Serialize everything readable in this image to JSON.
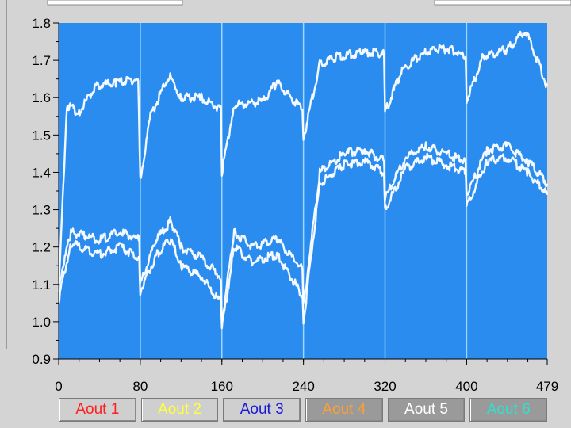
{
  "chart_data": {
    "type": "line",
    "y_ticks": [
      "1.8",
      "1.7",
      "1.6",
      "1.5",
      "1.4",
      "1.3",
      "1.2",
      "1.1",
      "1.0",
      "0.9"
    ],
    "x_ticks": [
      "0",
      "80",
      "160",
      "240",
      "320",
      "400",
      "479"
    ],
    "xlim": [
      0,
      479
    ],
    "ylim": [
      0.9,
      1.8
    ],
    "grid": "vertical at 80,160,240,320,400",
    "plot_bg": "#2b8cf0",
    "line_color": "#ffffff",
    "series": [
      {
        "name": "Aout 1",
        "points": [
          [
            0,
            1.08
          ],
          [
            8,
            1.58
          ],
          [
            20,
            1.56
          ],
          [
            36,
            1.63
          ],
          [
            56,
            1.64
          ],
          [
            78,
            1.65
          ],
          [
            80,
            1.38
          ],
          [
            90,
            1.55
          ],
          [
            108,
            1.66
          ],
          [
            120,
            1.6
          ],
          [
            140,
            1.6
          ],
          [
            159,
            1.57
          ],
          [
            160,
            1.4
          ],
          [
            172,
            1.58
          ],
          [
            200,
            1.59
          ],
          [
            214,
            1.64
          ],
          [
            239,
            1.57
          ],
          [
            240,
            1.49
          ],
          [
            256,
            1.69
          ],
          [
            272,
            1.71
          ],
          [
            296,
            1.72
          ],
          [
            319,
            1.72
          ],
          [
            320,
            1.56
          ],
          [
            336,
            1.67
          ],
          [
            352,
            1.71
          ],
          [
            368,
            1.73
          ],
          [
            384,
            1.73
          ],
          [
            399,
            1.71
          ],
          [
            400,
            1.59
          ],
          [
            416,
            1.71
          ],
          [
            440,
            1.73
          ],
          [
            458,
            1.78
          ],
          [
            479,
            1.63
          ]
        ]
      },
      {
        "name": "Aout 2",
        "points": [
          [
            0,
            1.1
          ],
          [
            12,
            1.24
          ],
          [
            40,
            1.22
          ],
          [
            60,
            1.24
          ],
          [
            79,
            1.22
          ],
          [
            80,
            1.1
          ],
          [
            96,
            1.22
          ],
          [
            110,
            1.27
          ],
          [
            120,
            1.2
          ],
          [
            140,
            1.17
          ],
          [
            159,
            1.12
          ],
          [
            160,
            1.0
          ],
          [
            172,
            1.24
          ],
          [
            190,
            1.2
          ],
          [
            214,
            1.22
          ],
          [
            239,
            1.14
          ],
          [
            240,
            1.04
          ],
          [
            256,
            1.4
          ],
          [
            280,
            1.45
          ],
          [
            300,
            1.46
          ],
          [
            319,
            1.43
          ],
          [
            320,
            1.33
          ],
          [
            340,
            1.44
          ],
          [
            360,
            1.47
          ],
          [
            380,
            1.45
          ],
          [
            399,
            1.43
          ],
          [
            400,
            1.34
          ],
          [
            420,
            1.46
          ],
          [
            440,
            1.47
          ],
          [
            460,
            1.43
          ],
          [
            479,
            1.37
          ]
        ]
      },
      {
        "name": "Aout 3",
        "points": [
          [
            0,
            1.06
          ],
          [
            12,
            1.21
          ],
          [
            40,
            1.18
          ],
          [
            60,
            1.2
          ],
          [
            79,
            1.17
          ],
          [
            80,
            1.08
          ],
          [
            96,
            1.18
          ],
          [
            110,
            1.22
          ],
          [
            120,
            1.15
          ],
          [
            140,
            1.12
          ],
          [
            159,
            1.05
          ],
          [
            160,
            0.98
          ],
          [
            172,
            1.2
          ],
          [
            190,
            1.16
          ],
          [
            214,
            1.18
          ],
          [
            239,
            1.07
          ],
          [
            240,
            1.0
          ],
          [
            256,
            1.37
          ],
          [
            280,
            1.42
          ],
          [
            300,
            1.43
          ],
          [
            319,
            1.4
          ],
          [
            320,
            1.3
          ],
          [
            340,
            1.41
          ],
          [
            360,
            1.44
          ],
          [
            380,
            1.42
          ],
          [
            399,
            1.4
          ],
          [
            400,
            1.31
          ],
          [
            420,
            1.43
          ],
          [
            440,
            1.44
          ],
          [
            460,
            1.4
          ],
          [
            479,
            1.34
          ]
        ]
      },
      {
        "name": "Aout 4",
        "points": []
      },
      {
        "name": "Aout 5",
        "points": []
      },
      {
        "name": "Aout 6",
        "points": []
      }
    ]
  },
  "legend": [
    {
      "label": "Aout 1",
      "color": "#ff2020"
    },
    {
      "label": "Aout 2",
      "color": "#ffff40"
    },
    {
      "label": "Aout 3",
      "color": "#1a1ad6"
    },
    {
      "label": "Aout 4",
      "color": "#ffa030",
      "bg": "#9a9a9a"
    },
    {
      "label": "Aout 5",
      "color": "#ffffff",
      "bg": "#9a9a9a"
    },
    {
      "label": "Aout 6",
      "color": "#30e0d0",
      "bg": "#9a9a9a"
    }
  ]
}
